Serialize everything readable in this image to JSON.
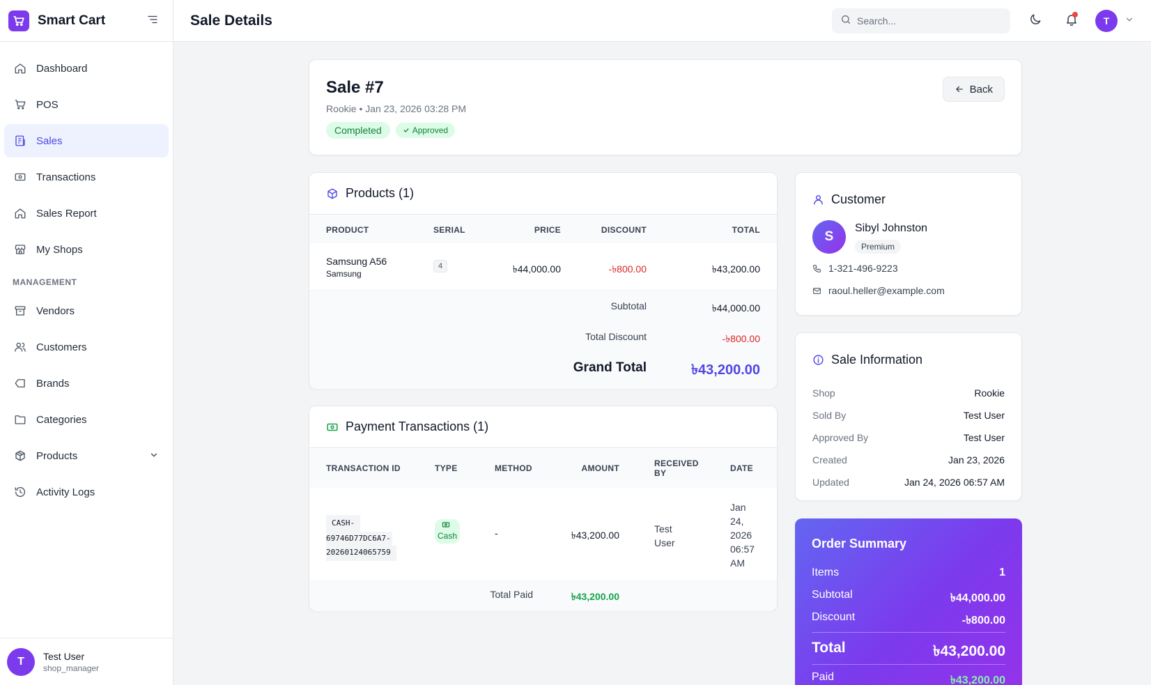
{
  "app": {
    "name": "Smart Cart"
  },
  "sidebar": {
    "items": [
      {
        "label": "Dashboard",
        "icon": "home-icon"
      },
      {
        "label": "POS",
        "icon": "cart-icon"
      },
      {
        "label": "Sales",
        "icon": "receipt-icon",
        "active": true
      },
      {
        "label": "Transactions",
        "icon": "cash-icon"
      },
      {
        "label": "Sales Report",
        "icon": "home-icon"
      },
      {
        "label": "My Shops",
        "icon": "store-icon"
      }
    ],
    "section_label": "MANAGEMENT",
    "management_items": [
      {
        "label": "Vendors",
        "icon": "archive-icon"
      },
      {
        "label": "Customers",
        "icon": "users-icon"
      },
      {
        "label": "Brands",
        "icon": "tag-icon"
      },
      {
        "label": "Categories",
        "icon": "folder-icon"
      },
      {
        "label": "Products",
        "icon": "box-icon",
        "has_submenu": true
      },
      {
        "label": "Activity Logs",
        "icon": "history-icon"
      }
    ],
    "user": {
      "initial": "T",
      "name": "Test User",
      "role": "shop_manager"
    }
  },
  "header": {
    "title": "Sale Details",
    "search_placeholder": "Search...",
    "user_initial": "T"
  },
  "sale": {
    "title": "Sale #7",
    "meta": "Rookie • Jan 23, 2026 03:28 PM",
    "status": "Completed",
    "approval": "Approved",
    "back_label": "Back"
  },
  "products": {
    "title": "Products (1)",
    "columns": [
      "PRODUCT",
      "SERIAL",
      "PRICE",
      "DISCOUNT",
      "TOTAL"
    ],
    "rows": [
      {
        "name": "Samsung A56",
        "brand": "Samsung",
        "serial": "4",
        "price": "৳44,000.00",
        "discount": "-৳800.00",
        "total": "৳43,200.00"
      }
    ],
    "subtotal_label": "Subtotal",
    "subtotal": "৳44,000.00",
    "total_discount_label": "Total Discount",
    "total_discount": "-৳800.00",
    "grand_total_label": "Grand Total",
    "grand_total": "৳43,200.00"
  },
  "payments": {
    "title": "Payment Transactions (1)",
    "columns": [
      "TRANSACTION ID",
      "TYPE",
      "METHOD",
      "AMOUNT",
      "RECEIVED BY",
      "DATE"
    ],
    "received_by_line1": "RECEIVED",
    "received_by_line2": "BY",
    "rows": [
      {
        "id_line1": "CASH-",
        "id_line2": "69746D77DC6A7-",
        "id_line3": "20260124065759",
        "type": "Cash",
        "method": "-",
        "amount": "৳43,200.00",
        "received_line1": "Test",
        "received_line2": "User",
        "date_line1": "Jan",
        "date_line2": "24,",
        "date_line3": "2026",
        "date_line4": "06:57",
        "date_line5": "AM"
      }
    ],
    "total_paid_label": "Total Paid",
    "total_paid": "৳43,200.00"
  },
  "customer": {
    "title": "Customer",
    "initial": "S",
    "name": "Sibyl Johnston",
    "tier": "Premium",
    "phone": "1-321-496-9223",
    "email": "raoul.heller@example.com"
  },
  "sale_info": {
    "title": "Sale Information",
    "rows": [
      {
        "label": "Shop",
        "value": "Rookie"
      },
      {
        "label": "Sold By",
        "value": "Test User"
      },
      {
        "label": "Approved By",
        "value": "Test User"
      },
      {
        "label": "Created",
        "value": "Jan 23, 2026"
      },
      {
        "label": "Updated",
        "value": "Jan 24, 2026 06:57 AM"
      }
    ]
  },
  "order_summary": {
    "title": "Order Summary",
    "items_label": "Items",
    "items": "1",
    "subtotal_label": "Subtotal",
    "subtotal": "৳44,000.00",
    "discount_label": "Discount",
    "discount": "-৳800.00",
    "total_label": "Total",
    "total": "৳43,200.00",
    "paid_label": "Paid",
    "paid": "৳43,200.00"
  },
  "colors": {
    "accent": "#4f46e5",
    "brand": "#7c3aed",
    "success": "#16a34a",
    "danger": "#dc2626"
  }
}
